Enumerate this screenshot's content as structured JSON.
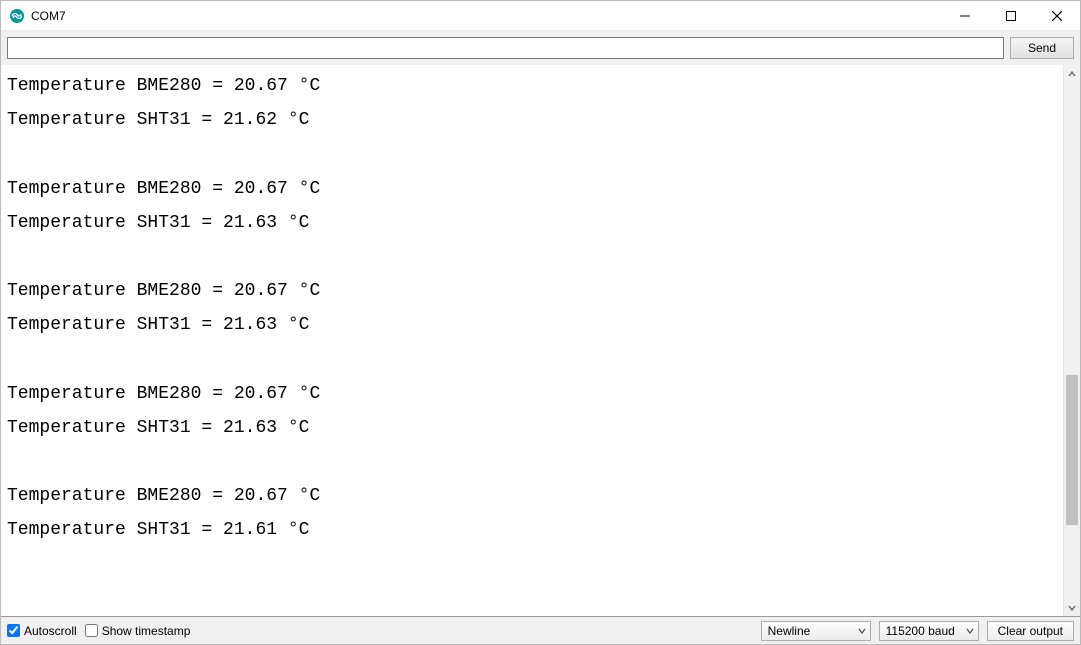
{
  "window": {
    "title": "COM7"
  },
  "toolbar": {
    "send_label": "Send",
    "input_value": ""
  },
  "console": {
    "lines": [
      "Temperature BME280 = 20.67 °C",
      "Temperature SHT31 = 21.62 °C",
      "",
      "Temperature BME280 = 20.67 °C",
      "Temperature SHT31 = 21.63 °C",
      "",
      "Temperature BME280 = 20.67 °C",
      "Temperature SHT31 = 21.63 °C",
      "",
      "Temperature BME280 = 20.67 °C",
      "Temperature SHT31 = 21.63 °C",
      "",
      "Temperature BME280 = 20.67 °C",
      "Temperature SHT31 = 21.61 °C"
    ]
  },
  "bottom": {
    "autoscroll_label": "Autoscroll",
    "autoscroll_checked": true,
    "show_timestamp_label": "Show timestamp",
    "show_timestamp_checked": false,
    "line_ending_selected": "Newline",
    "baud_selected": "115200 baud",
    "clear_label": "Clear output"
  }
}
